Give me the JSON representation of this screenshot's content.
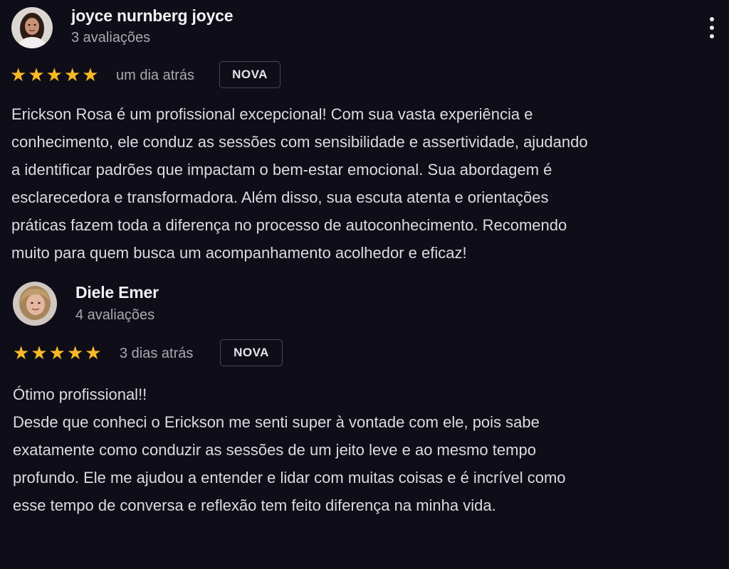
{
  "reviews": [
    {
      "name": "joyce nurnberg joyce",
      "count": "3 avaliações",
      "rating": 5,
      "time": "um dia atrás",
      "badge": "NOVA",
      "lines": [
        "Erickson Rosa é um profissional excepcional! Com sua vasta experiência e",
        "conhecimento, ele conduz as sessões com sensibilidade e assertividade, ajudando",
        "a identificar padrões que impactam o bem-estar emocional. Sua abordagem é",
        "esclarecedora e transformadora. Além disso, sua escuta atenta e orientações",
        "práticas fazem toda a diferença no processo de autoconhecimento. Recomendo",
        "muito para quem busca um acompanhamento acolhedor e eficaz!"
      ]
    },
    {
      "name": "Diele Emer",
      "count": "4 avaliações",
      "rating": 5,
      "time": "3 dias atrás",
      "badge": "NOVA",
      "lines": [
        "Ótimo profissional!!",
        "Desde que conheci o Erickson me senti super à vontade com ele, pois sabe",
        "exatamente como conduzir as sessões de um jeito leve e ao mesmo tempo",
        "profundo. Ele me ajudou a entender e lidar com muitas coisas e é incrível como",
        "esse tempo de conversa e reflexão tem feito diferença na minha vida."
      ]
    }
  ],
  "icons": {
    "star": "star-icon",
    "menu": "more-vert-icon"
  },
  "colors": {
    "background": "#0f0d17",
    "star": "#f7b928"
  }
}
